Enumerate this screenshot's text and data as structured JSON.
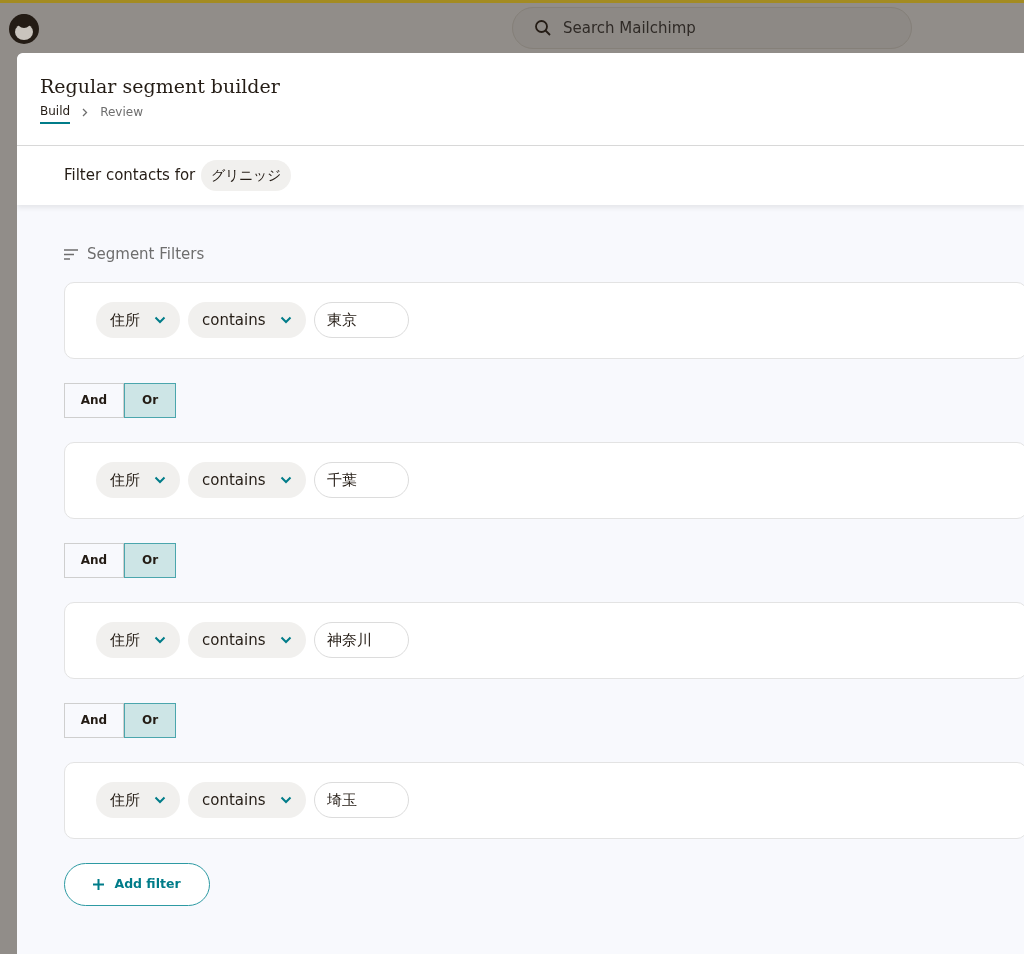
{
  "app": {
    "search": {
      "placeholder": "Search Mailchimp"
    }
  },
  "modal": {
    "title": "Regular segment builder",
    "steps": [
      {
        "label": "Build",
        "selected": true
      },
      {
        "label": "Review",
        "selected": false
      }
    ],
    "audience": {
      "label": "Filter contacts for",
      "value": "グリニッジ"
    },
    "filters_heading": "Segment Filters",
    "filters": [
      {
        "field": "住所",
        "operator": "contains",
        "value": "東京"
      },
      {
        "field": "住所",
        "operator": "contains",
        "value": "千葉"
      },
      {
        "field": "住所",
        "operator": "contains",
        "value": "神奈川"
      },
      {
        "field": "住所",
        "operator": "contains",
        "value": "埼玉"
      }
    ],
    "connectors": [
      {
        "options": [
          {
            "label": "And",
            "selected": false
          },
          {
            "label": "Or",
            "selected": true
          }
        ]
      },
      {
        "options": [
          {
            "label": "And",
            "selected": false
          },
          {
            "label": "Or",
            "selected": true
          }
        ]
      },
      {
        "options": [
          {
            "label": "And",
            "selected": false
          },
          {
            "label": "Or",
            "selected": true
          }
        ]
      }
    ],
    "add_button": "Add filter"
  }
}
